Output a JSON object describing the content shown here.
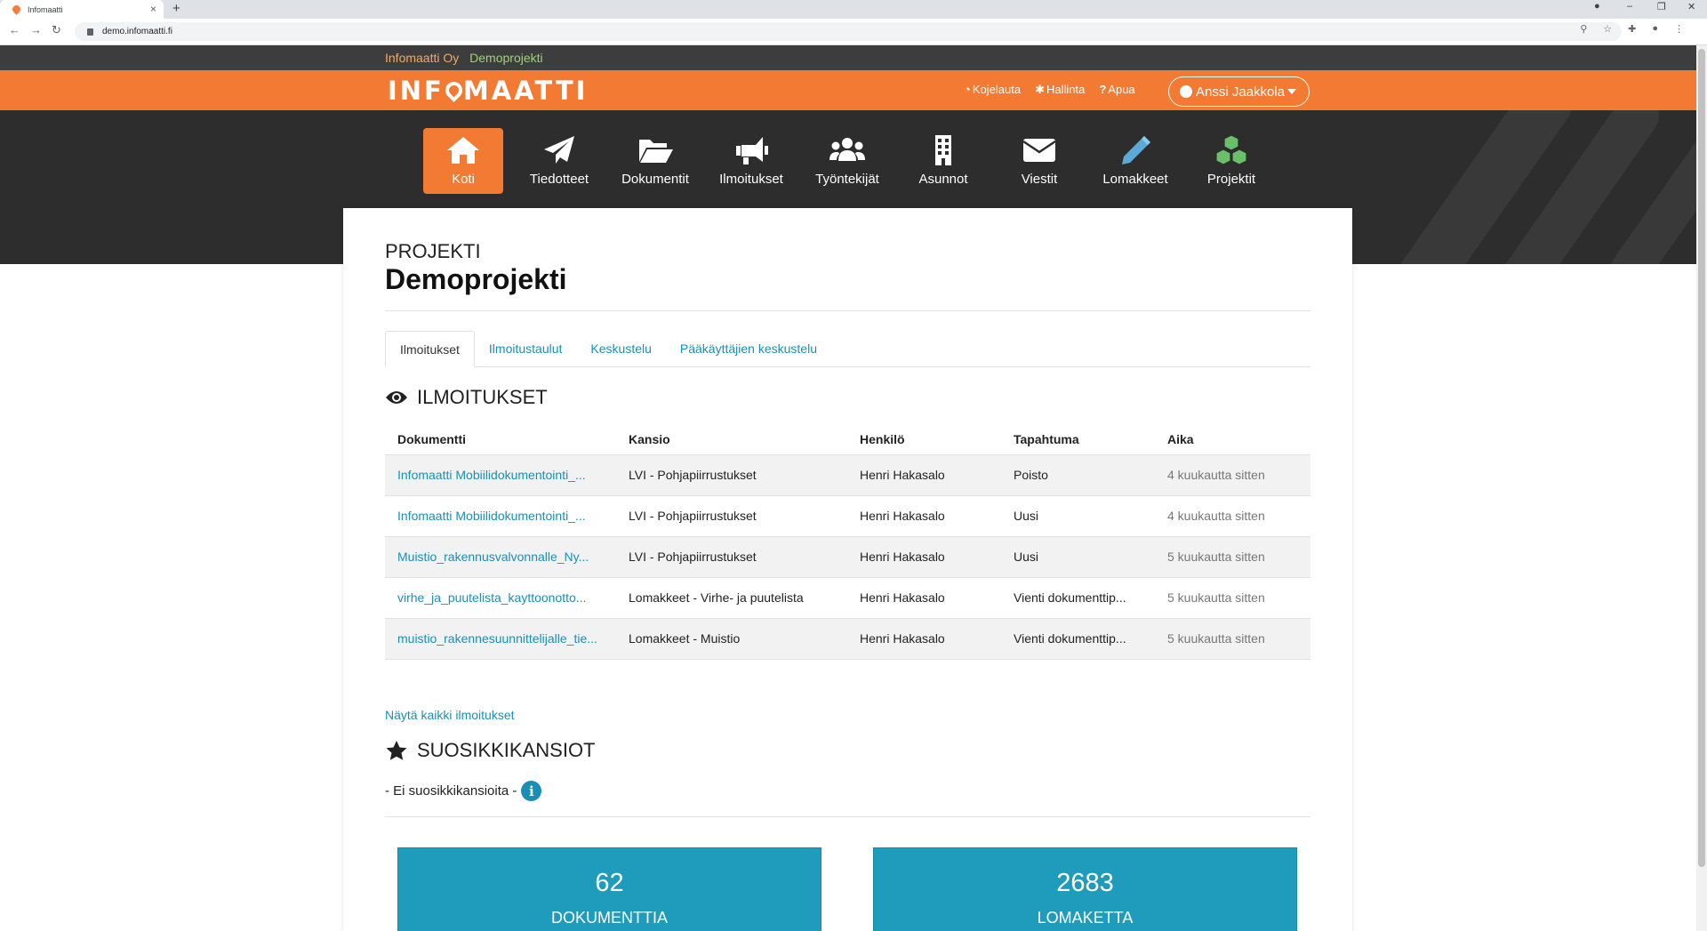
{
  "browser": {
    "tab_title": "Infomaatti",
    "url": "demo.infomaatti.fi"
  },
  "header": {
    "company": "Infomaatti Oy",
    "project": "Demoprojekti",
    "logo_left": "INF",
    "logo_right": "MAATTI",
    "links": [
      {
        "icon": "dashboard-icon",
        "label": "Kojelauta"
      },
      {
        "icon": "gear-icon",
        "label": "Hallinta"
      },
      {
        "icon": "question-icon",
        "label": "Apua"
      }
    ],
    "user": "Anssi Jaakkola"
  },
  "nav": [
    {
      "label": "Koti",
      "icon": "home-icon",
      "active": true
    },
    {
      "label": "Tiedotteet",
      "icon": "paper-plane-icon"
    },
    {
      "label": "Dokumentit",
      "icon": "folder-open-icon"
    },
    {
      "label": "Ilmoitukset",
      "icon": "megaphone-icon"
    },
    {
      "label": "Työntekijät",
      "icon": "users-icon"
    },
    {
      "label": "Asunnot",
      "icon": "building-icon"
    },
    {
      "label": "Viestit",
      "icon": "envelope-icon"
    },
    {
      "label": "Lomakkeet",
      "icon": "pencil-icon"
    },
    {
      "label": "Projektit",
      "icon": "cubes-icon"
    }
  ],
  "page": {
    "pre_title": "PROJEKTI",
    "title": "Demoprojekti"
  },
  "tabs": [
    "Ilmoitukset",
    "Ilmoitustaulut",
    "Keskustelu",
    "Pääkäyttäjien keskustelu"
  ],
  "notifications": {
    "heading": "ILMOITUKSET",
    "columns": [
      "Dokumentti",
      "Kansio",
      "Henkilö",
      "Tapahtuma",
      "Aika"
    ],
    "rows": [
      [
        "Infomaatti Mobiilidokumentointi_...",
        "LVI - Pohjapiirrustukset",
        "Henri Hakasalo",
        "Poisto",
        "4 kuukautta sitten"
      ],
      [
        "Infomaatti Mobiilidokumentointi_...",
        "LVI - Pohjapiirrustukset",
        "Henri Hakasalo",
        "Uusi",
        "4 kuukautta sitten"
      ],
      [
        "Muistio_rakennusvalvonnalle_Ny...",
        "LVI - Pohjapiirrustukset",
        "Henri Hakasalo",
        "Uusi",
        "5 kuukautta sitten"
      ],
      [
        "virhe_ja_puutelista_kayttoonotto...",
        "Lomakkeet - Virhe- ja puutelista",
        "Henri Hakasalo",
        "Vienti dokumenttip...",
        "5 kuukautta sitten"
      ],
      [
        "muistio_rakennesuunnittelijalle_tie...",
        "Lomakkeet - Muistio",
        "Henri Hakasalo",
        "Vienti dokumenttip...",
        "5 kuukautta sitten"
      ]
    ],
    "show_all": "Näytä kaikki ilmoitukset"
  },
  "favorites": {
    "heading": "SUOSIKKIKANSIOT",
    "empty": "- Ei suosikkikansioita -"
  },
  "stats": [
    {
      "value": "62",
      "label": "DOKUMENTTIA"
    },
    {
      "value": "2683",
      "label": "LOMAKETTA"
    }
  ],
  "colors": {
    "brand_orange": "#f27a33",
    "dark_band": "#2d2d2d",
    "link_blue": "#1a8fb5",
    "stat_teal": "#1f9cbc"
  }
}
